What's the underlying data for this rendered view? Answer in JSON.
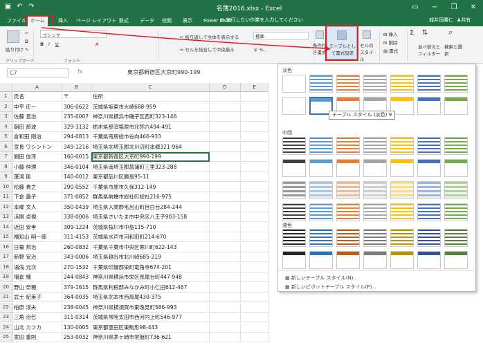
{
  "window": {
    "title": "名簿2016.xlsx - Excel",
    "user": "城井田勝仁",
    "share": "共有"
  },
  "tabs": [
    {
      "label": "ファイル"
    },
    {
      "label": "ホーム"
    },
    {
      "label": "挿入"
    },
    {
      "label": "ページ レイアウト"
    },
    {
      "label": "数式"
    },
    {
      "label": "データ"
    },
    {
      "label": "校閲"
    },
    {
      "label": "表示"
    },
    {
      "label": "Power Pivot"
    }
  ],
  "tellme": "実行したい作業を入力してください",
  "ribbon": {
    "paste": "貼り付け",
    "font": "ゴシック",
    "wrap_text": "折り返して全体を表示する",
    "number_format": "標準",
    "merge_center": "セルを結合して中央揃え",
    "cond_format": "条件付き書式",
    "format_as_table": "テーブルとして書式設定",
    "cell_styles": "セルのスタイル",
    "insert": "挿入",
    "delete": "削除",
    "format": "書式",
    "sort_filter": "並べ替えとフィルター",
    "find_select": "検索と選択",
    "group_clipboard": "クリップボード",
    "group_font": "フォント"
  },
  "formula_bar": {
    "name_box": "C7",
    "fx": "fx",
    "content": "東京都新宿区大京町990-199"
  },
  "grid": {
    "columns": [
      "A",
      "B",
      "C",
      "D",
      "E"
    ],
    "rows": [
      [
        "氏名",
        "〒",
        "住所"
      ],
      [
        "中平 庄一",
        "306-0622",
        "茨城県坂東市大崎688-959"
      ],
      [
        "佐藤 直治",
        "235-0007",
        "神奈川県横浜市磯子区西町323-146"
      ],
      [
        "朝田 那波",
        "329-3132",
        "栃木県那須塩原市北弥六494-491"
      ],
      [
        "倉和田 剛治",
        "294-0813",
        "千葉県南房総市谷向466-933"
      ],
      [
        "宣長 ワシントン",
        "349-1216",
        "埼玉県北埼玉郡北川辺町本郷321-964"
      ],
      [
        "劉田 信泽",
        "160-0015",
        "東京都新宿区大京町990-199"
      ],
      [
        "小藤 仲理",
        "346-0104",
        "埼玉県南埼玉郡菖蒲町三里323-288"
      ],
      [
        "蓬鴻 匡",
        "140-0012",
        "東京都品川区勝島95-11"
      ],
      [
        "松藤 貴之",
        "290-0552",
        "千葉県市原市久保312-149"
      ],
      [
        "下倉 露子",
        "371-0852",
        "群馬県前橋市総社町総社216-975"
      ],
      [
        "本郷 文人",
        "350-0439",
        "埼玉県入間郡毛呂山町目白台284-244"
      ],
      [
        "浜関 卓視",
        "338-0006",
        "埼玉県さいたま市中央区八王子903-158"
      ],
      [
        "近田 安孝",
        "309-1224",
        "茨城県桜川市中島115-710"
      ],
      [
        "福知山 明一郎",
        "311-4153",
        "茨城県水戸市河和田町214-670"
      ],
      [
        "日纂 邦治",
        "260-0832",
        "千葉県千葉市中央区寒川町622-143"
      ],
      [
        "新野 安治",
        "343-0006",
        "埼玉県越谷市北川崎685-219"
      ],
      [
        "湯浅 元次",
        "270-1532",
        "千葉県印旛郡栄町竜角寺674-201"
      ],
      [
        "増倉 槐",
        "244-0843",
        "神奈川県横浜市栄区長尾台町447-948"
      ],
      [
        "野山 奈穂",
        "379-1615",
        "群馬県利根郡みなかみ町小仁田612-467"
      ],
      [
        "武士 紀美子",
        "364-0035",
        "埼玉県北本市西高尾430-375"
      ],
      [
        "柏原 淳夫",
        "238-0045",
        "神奈川県横須賀市東逸見町586-993"
      ],
      [
        "三角 治巳",
        "311-0314",
        "茨城県常陸太田市西河内上町546-977"
      ],
      [
        "山北 カフカ",
        "130-0005",
        "東京都墨田区東駒形98-443"
      ],
      [
        "家田 重則",
        "253-0032",
        "神奈川県茅ヶ崎市常盤町736-621"
      ]
    ]
  },
  "gallery": {
    "light": "淡色",
    "medium": "中間",
    "dark": "濃色",
    "tooltip": "テーブル スタイル (淡色) 9",
    "new_table_style": "新しいテーブル スタイル(N)...",
    "new_pivot_style": "新しいピボットテーブル スタイル(P)...",
    "light_colors": [
      "#ffffff",
      "#5b9bd5",
      "#ed7d31",
      "#a5a5a5",
      "#ffc000",
      "#4472c4",
      "#70ad47"
    ],
    "medium_colors": [
      "#404040",
      "#5b9bd5",
      "#ed7d31",
      "#a5a5a5",
      "#ffc000",
      "#4472c4",
      "#70ad47"
    ],
    "dark_colors": [
      "#262626",
      "#2e75b6",
      "#c55a11",
      "#7b7b7b",
      "#bf9000",
      "#2f5597",
      "#548235"
    ]
  }
}
